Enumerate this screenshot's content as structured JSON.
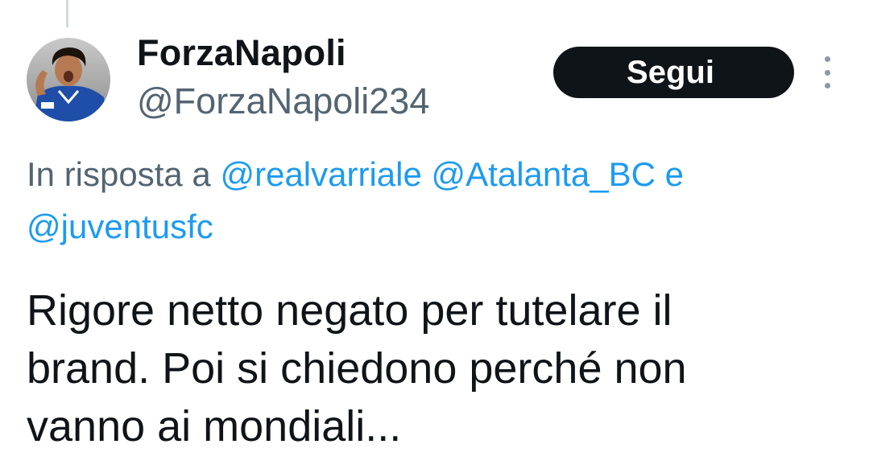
{
  "author": {
    "display_name": "ForzaNapoli",
    "handle": "@ForzaNapoli234"
  },
  "follow_button": {
    "label": "Segui"
  },
  "more_menu": {
    "icon": "more-vertical-icon"
  },
  "reply_context": {
    "prefix": "In risposta a",
    "mentions": [
      "@realvarriale",
      "@Atalanta_BC",
      "@juventusfc"
    ],
    "conjunction": "e"
  },
  "tweet": {
    "lines": [
      "Rigore netto negato per tutelare il",
      "brand. Poi si chiedono perché non",
      "vanno ai mondiali..."
    ]
  },
  "colors": {
    "accent": "#1d9bf0",
    "secondary_text": "#536471",
    "primary_text": "#0f1419",
    "button_bg": "#0f1419"
  }
}
